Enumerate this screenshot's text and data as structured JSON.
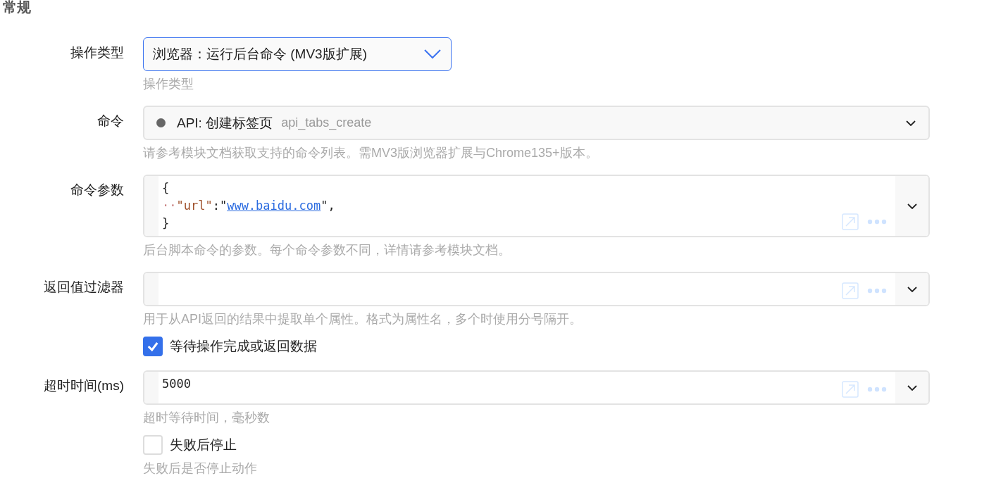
{
  "section": {
    "title": "常规"
  },
  "fields": [
    {
      "kind": "select",
      "label": "操作类型",
      "value": "浏览器：运行后台命令 (MV3版扩展)",
      "focused": true,
      "hint": "操作类型"
    },
    {
      "kind": "command",
      "label": "命令",
      "color": "#666666",
      "value": "API: 创建标签页",
      "code": "api_tabs_create",
      "hint": "请参考模块文档获取支持的命令列表。需MV3版浏览器扩展与Chrome135+版本。"
    },
    {
      "kind": "code",
      "label": "命令参数",
      "lines": [
        [
          {
            "kind": "punct",
            "text": "{"
          }
        ],
        [
          {
            "kind": "space",
            "text": "··"
          },
          {
            "kind": "key",
            "text": "\"url\""
          },
          {
            "kind": "punct",
            "text": ":\""
          },
          {
            "kind": "link",
            "text": "www.baidu.com"
          },
          {
            "kind": "punct",
            "text": "\","
          }
        ],
        [
          {
            "kind": "punct",
            "text": "}"
          }
        ]
      ],
      "hint": "后台脚本命令的参数。每个命令参数不同，详情请参考模块文档。"
    },
    {
      "kind": "code",
      "label": "返回值过滤器",
      "hint": "用于从API返回的结果中提取单个属性。格式为属性名，多个时使用分号隔开。"
    },
    {
      "kind": "checkbox",
      "label": "等待操作完成或返回数据",
      "checked": true
    },
    {
      "kind": "code",
      "label": "超时时间(ms)",
      "lines": [
        [
          {
            "kind": "plain",
            "text": "5000"
          }
        ]
      ],
      "hint": "超时等待时间，毫秒数"
    },
    {
      "kind": "checkbox",
      "label": "失败后停止",
      "checked": false,
      "hint": "失败后是否停止动作"
    }
  ]
}
